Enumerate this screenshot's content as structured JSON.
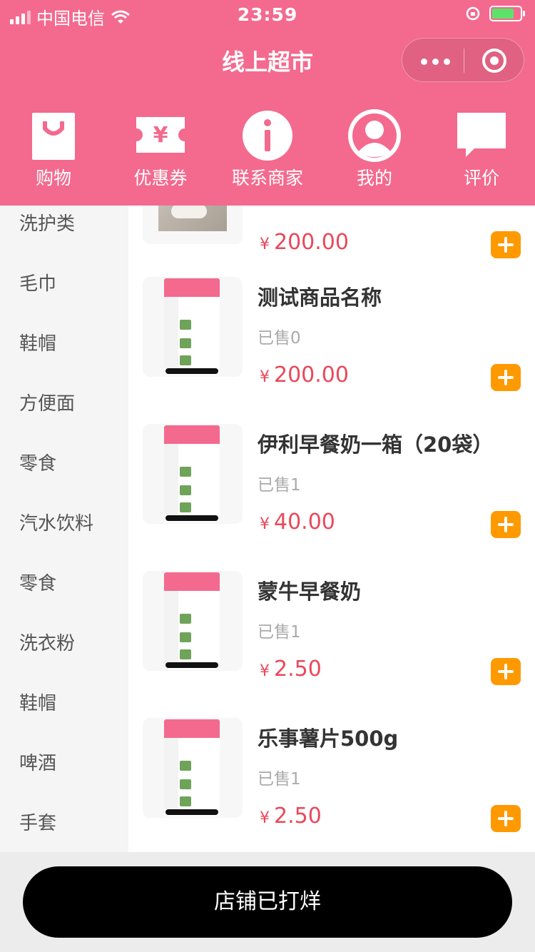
{
  "status_bar": {
    "carrier": "中国电信",
    "time": "23:59"
  },
  "nav": {
    "title": "线上超市"
  },
  "icon_bar": [
    {
      "label": "购物",
      "icon": "shopping-bag-icon"
    },
    {
      "label": "优惠券",
      "icon": "coupon-icon"
    },
    {
      "label": "联系商家",
      "icon": "info-icon"
    },
    {
      "label": "我的",
      "icon": "user-icon"
    },
    {
      "label": "评价",
      "icon": "comment-icon"
    }
  ],
  "categories": [
    "洗护类",
    "毛巾",
    "鞋帽",
    "方便面",
    "零食",
    "汽水饮料",
    "零食",
    "洗衣粉",
    "鞋帽",
    "啤酒",
    "手套"
  ],
  "products": [
    {
      "name": "",
      "sold": "",
      "currency": "¥",
      "price": "200.00"
    },
    {
      "name": "测试商品名称",
      "sold": "已售0",
      "currency": "¥",
      "price": "200.00"
    },
    {
      "name": "伊利早餐奶一箱（20袋）",
      "sold": "已售1",
      "currency": "¥",
      "price": "40.00"
    },
    {
      "name": "蒙牛早餐奶",
      "sold": "已售1",
      "currency": "¥",
      "price": "2.50"
    },
    {
      "name": "乐事薯片500g",
      "sold": "已售1",
      "currency": "¥",
      "price": "2.50"
    }
  ],
  "footer": {
    "button_label": "店铺已打烊"
  },
  "colors": {
    "brand": "#f36a8e",
    "price": "#e9485a",
    "add_button": "#ff9900"
  }
}
